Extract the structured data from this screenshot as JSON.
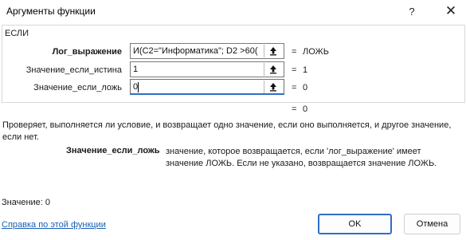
{
  "window": {
    "title": "Аргументы функции",
    "help_glyph": "?",
    "close_glyph": "✕"
  },
  "function_group": {
    "name": "ЕСЛИ"
  },
  "arguments": [
    {
      "label": "Лог_выражение",
      "value": "И(C2=\"Информатика\"; D2 >60(",
      "equals": "=",
      "result": "ЛОЖЬ"
    },
    {
      "label": "Значение_если_истина",
      "value": "1",
      "equals": "=",
      "result": "1"
    },
    {
      "label": "Значение_если_ложь",
      "value": "0",
      "equals": "=",
      "result": "0"
    }
  ],
  "formula_result": {
    "equals": "=",
    "value": "0"
  },
  "description": "Проверяет, выполняется ли условие, и возвращает одно значение, если оно выполняется, и другое значение, если нет.",
  "parameter_help": {
    "name": "Значение_если_ложь",
    "text": "значение, которое возвращается, если 'лог_выражение' имеет значение ЛОЖЬ. Если не указано, возвращается значение ЛОЖЬ."
  },
  "value_line": "Значение:   0",
  "help_link": "Справка по этой функции",
  "buttons": {
    "ok": "OK",
    "cancel": "Отмена"
  },
  "colors": {
    "accent": "#2f6fc4",
    "link": "#1a5fb4"
  },
  "icons": {
    "ref_button": "collapse-dialog-arrow-icon"
  }
}
